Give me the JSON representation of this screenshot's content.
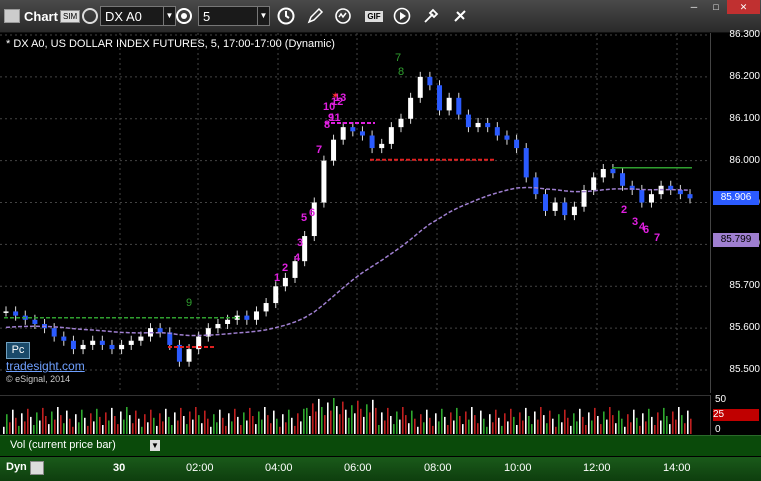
{
  "toolbar": {
    "app_title": "Chart",
    "sim_badge": "SIM",
    "symbol": "DX A0",
    "interval": "5",
    "gif_label": "GIF"
  },
  "chart": {
    "header": "* DX A0, US DOLLAR INDEX FUTURES, 5, 17:00-17:00 (Dynamic)",
    "pc_badge": "Pc",
    "watermark": "tradesight.com",
    "copyright": "© eSignal, 2014"
  },
  "price_axis": {
    "ticks": [
      "86.300",
      "86.200",
      "86.100",
      "86.000",
      "85.900",
      "85.800",
      "85.700",
      "85.600",
      "85.500"
    ],
    "last_price": "85.906",
    "ma_price": "85.799"
  },
  "volume": {
    "ticks": [
      "50",
      "25",
      "0"
    ],
    "label": "Vol (current price bar)",
    "current_badge": "25"
  },
  "time_axis": {
    "dyn_label": "Dyn",
    "ticks": [
      "30",
      "02:00",
      "04:00",
      "06:00",
      "08:00",
      "10:00",
      "12:00",
      "14:00"
    ]
  },
  "chart_data": {
    "type": "candlestick",
    "title": "* DX A0, US DOLLAR INDEX FUTURES, 5, 17:00-17:00 (Dynamic)",
    "ylim": [
      85.45,
      86.3
    ],
    "last_price": 85.906,
    "moving_average_last": 85.799,
    "colors": {
      "up": "#ffffff",
      "down": "#2b5bff",
      "ma": "#9f7fd0",
      "td_count": "#e020e0",
      "setup": "#2fa02f",
      "support": "#e02020",
      "resistance": "#2fa02f"
    },
    "close_series": [
      85.64,
      85.63,
      85.62,
      85.61,
      85.6,
      85.58,
      85.57,
      85.55,
      85.56,
      85.57,
      85.56,
      85.55,
      85.56,
      85.57,
      85.58,
      85.6,
      85.59,
      85.56,
      85.52,
      85.55,
      85.58,
      85.6,
      85.61,
      85.62,
      85.63,
      85.62,
      85.64,
      85.66,
      85.7,
      85.72,
      85.76,
      85.82,
      85.9,
      86.0,
      86.05,
      86.08,
      86.07,
      86.06,
      86.03,
      86.04,
      86.08,
      86.1,
      86.15,
      86.2,
      86.18,
      86.12,
      86.15,
      86.11,
      86.08,
      86.09,
      86.08,
      86.06,
      86.05,
      86.03,
      85.96,
      85.92,
      85.88,
      85.9,
      85.87,
      85.89,
      85.93,
      85.96,
      85.98,
      85.97,
      85.94,
      85.93,
      85.9,
      85.92,
      85.94,
      85.93,
      85.92,
      85.91
    ],
    "td_labels_magenta": [
      "1",
      "2",
      "3",
      "4",
      "5",
      "6",
      "7",
      "8",
      "9",
      "10",
      "11",
      "12",
      "13",
      "2",
      "3",
      "4",
      "6",
      "7"
    ],
    "setup_labels_green": [
      "7",
      "8",
      "9"
    ]
  }
}
